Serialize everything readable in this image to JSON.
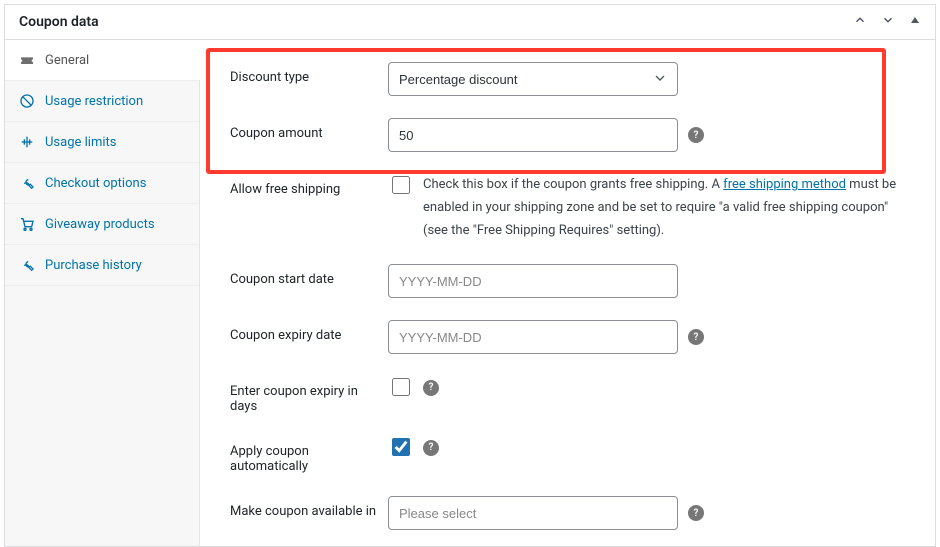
{
  "panel": {
    "title": "Coupon data"
  },
  "sidebar": {
    "items": [
      {
        "label": "General"
      },
      {
        "label": "Usage restriction"
      },
      {
        "label": "Usage limits"
      },
      {
        "label": "Checkout options"
      },
      {
        "label": "Giveaway products"
      },
      {
        "label": "Purchase history"
      }
    ]
  },
  "fields": {
    "discount_type": {
      "label": "Discount type",
      "value": "Percentage discount"
    },
    "coupon_amount": {
      "label": "Coupon amount",
      "value": "50"
    },
    "allow_free_shipping": {
      "label": "Allow free shipping",
      "checked": false,
      "text_before": "Check this box if the coupon grants free shipping. A ",
      "link_text": "free shipping method",
      "text_after": " must be enabled in your shipping zone and be set to require \"a valid free shipping coupon\" (see the \"Free Shipping Requires\" setting)."
    },
    "start_date": {
      "label": "Coupon start date",
      "placeholder": "YYYY-MM-DD",
      "value": ""
    },
    "expiry_date": {
      "label": "Coupon expiry date",
      "placeholder": "YYYY-MM-DD",
      "value": ""
    },
    "expiry_in_days": {
      "label": "Enter coupon expiry in days",
      "checked": false
    },
    "apply_auto": {
      "label": "Apply coupon automatically",
      "checked": true
    },
    "available_in": {
      "label": "Make coupon available in",
      "placeholder": "Please select",
      "value": ""
    }
  }
}
